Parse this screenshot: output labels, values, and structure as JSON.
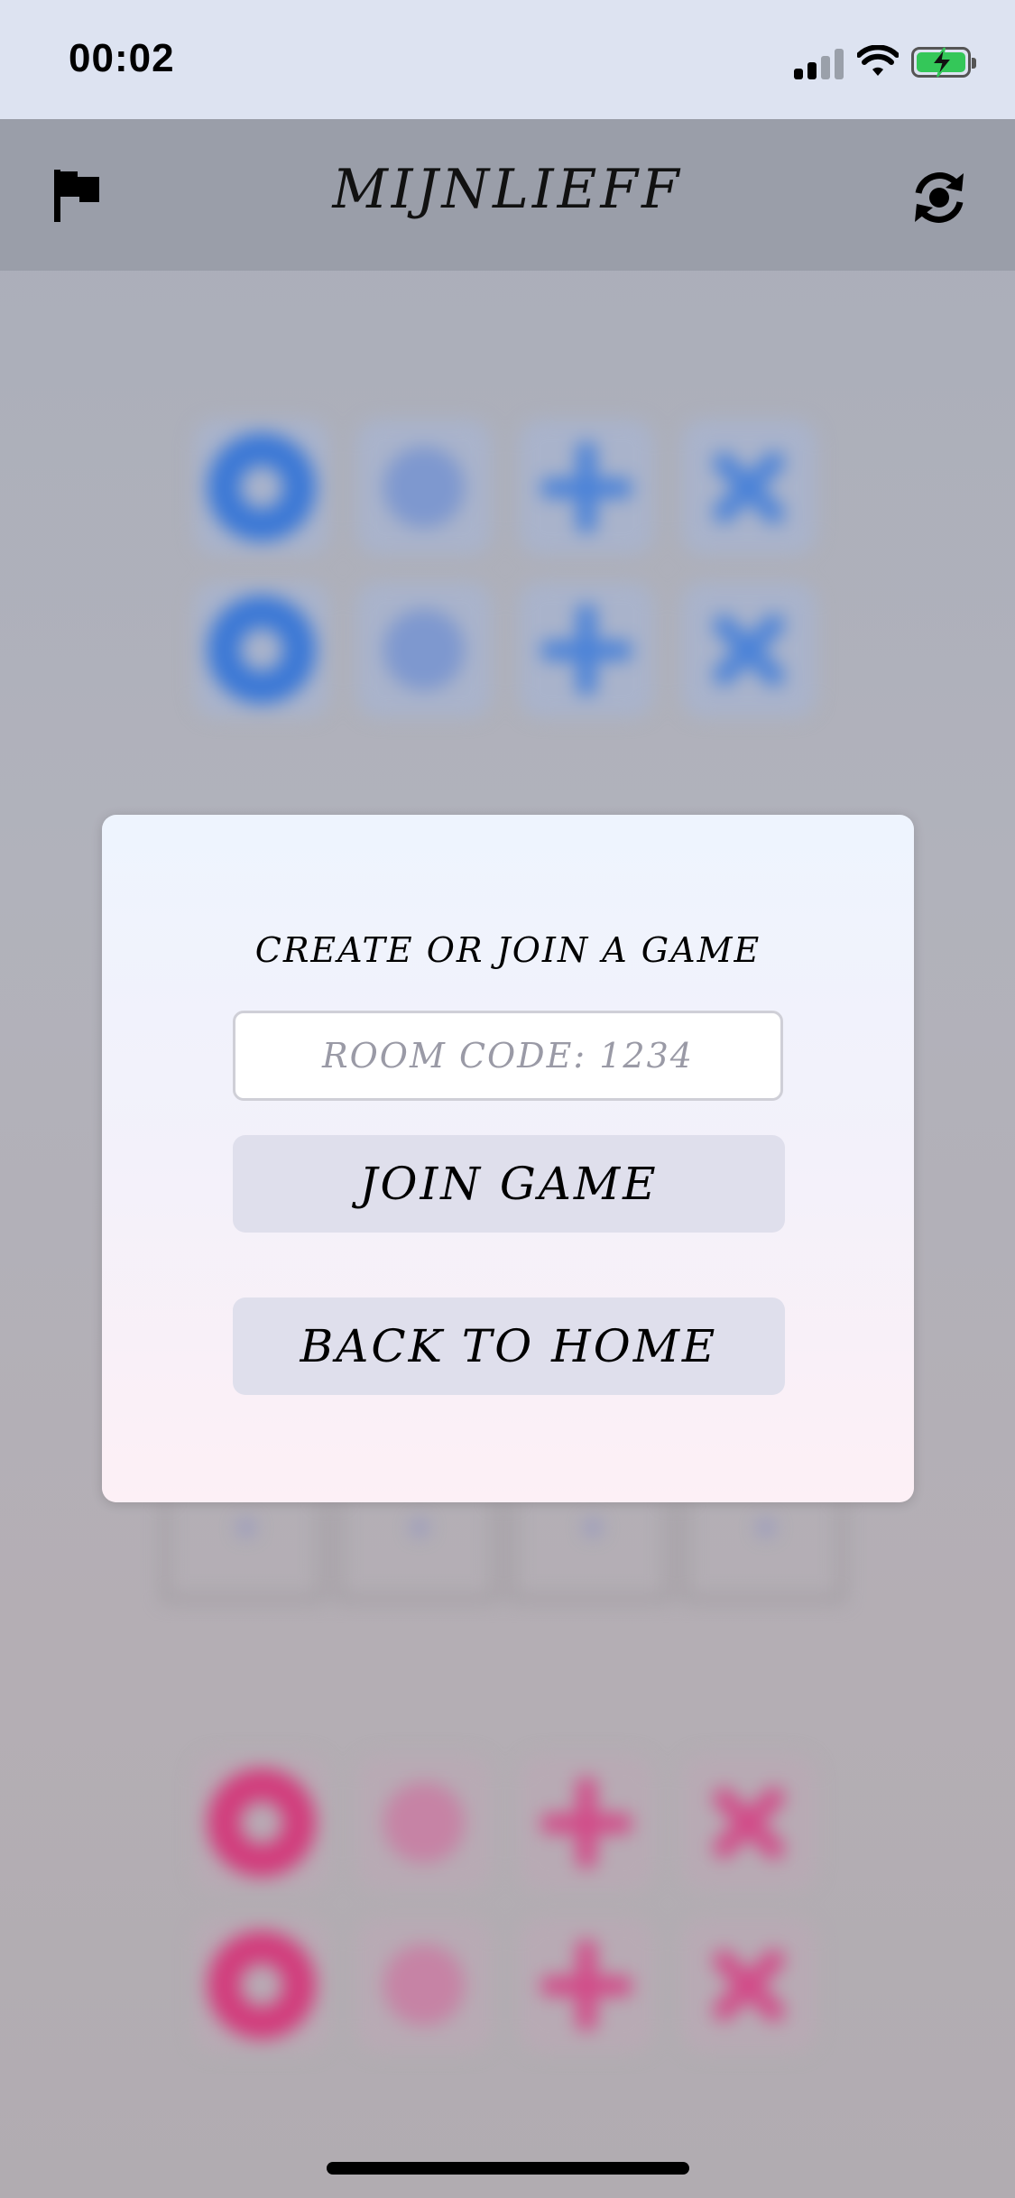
{
  "status_bar": {
    "time": "00:02",
    "icons": [
      "cellular-signal-icon",
      "wifi-icon",
      "battery-charging-icon"
    ]
  },
  "header": {
    "title": "MIJNLIEFF",
    "left_icon": "flag-icon",
    "right_icon": "refresh-icon"
  },
  "modal": {
    "title": "CREATE OR JOIN A GAME",
    "room_code": {
      "value": "",
      "placeholder": "ROOM CODE: 1234"
    },
    "join_button": "JOIN GAME",
    "back_button": "BACK TO HOME"
  },
  "colors": {
    "player_one": "#3b78d6",
    "player_two": "#d23c7c",
    "battery": "#34c759",
    "button_bg": "#dfdfec"
  }
}
